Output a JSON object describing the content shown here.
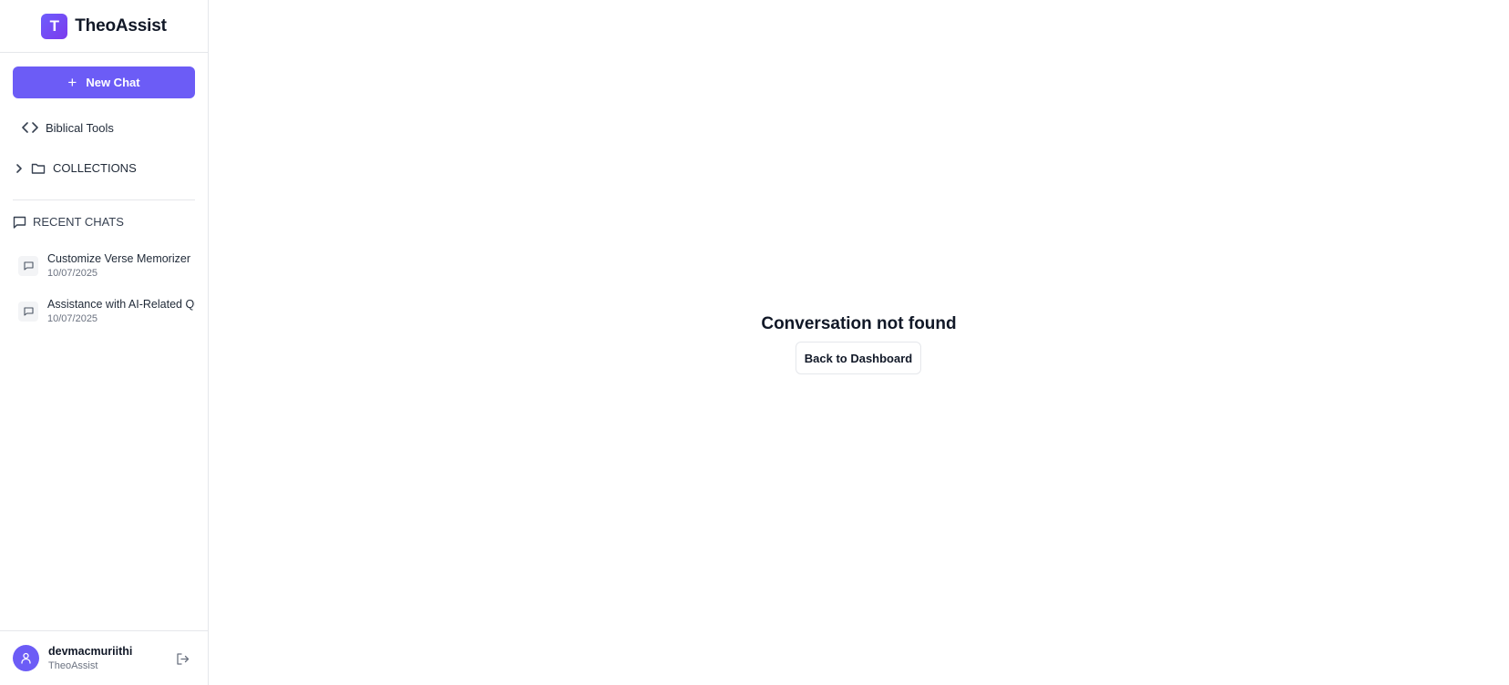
{
  "brand": {
    "logo_letter": "T",
    "name": "TheoAssist",
    "accent": "#6c5cf6"
  },
  "sidebar": {
    "new_chat_label": "New Chat",
    "tools_label": "Biblical Tools",
    "collections_label": "COLLECTIONS",
    "recent_header": "RECENT CHATS",
    "recent_chats": [
      {
        "title": "Customize Verse Memorizer",
        "date": "10/07/2025"
      },
      {
        "title": "Assistance with AI-Related Qu",
        "date": "10/07/2025"
      }
    ]
  },
  "user": {
    "name": "devmacmuriithi",
    "subtitle": "TheoAssist"
  },
  "main": {
    "message": "Conversation not found",
    "back_button_label": "Back to Dashboard"
  }
}
